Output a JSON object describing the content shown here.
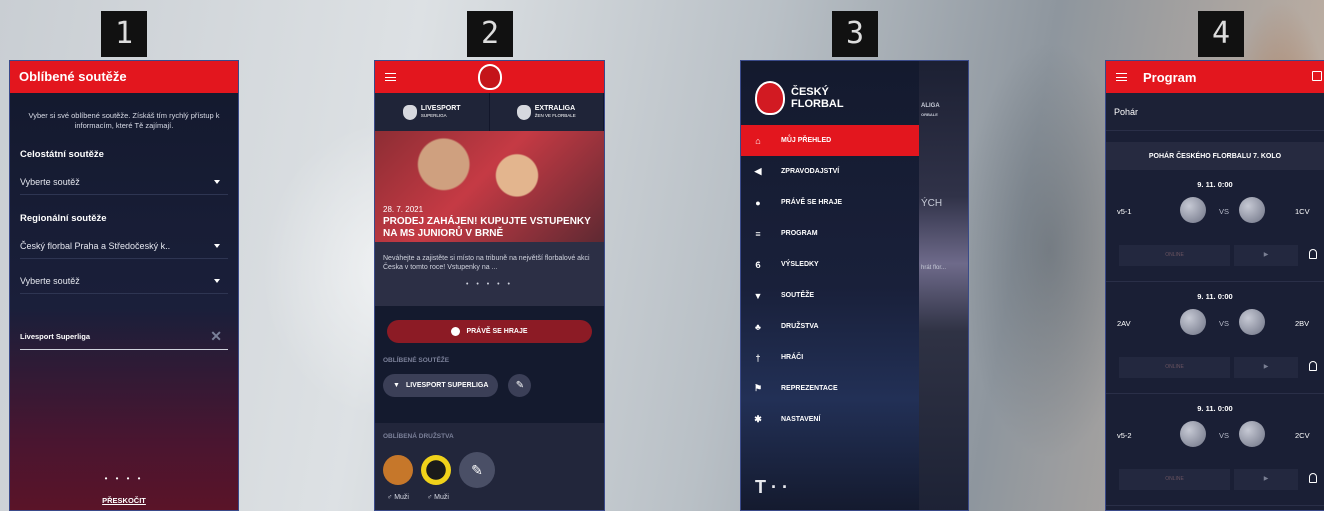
{
  "labels": [
    "1",
    "2",
    "3",
    "4"
  ],
  "screen1": {
    "title": "Oblíbené soutěže",
    "intro": "Vyber si své oblíbené soutěže. Získáš tím rychlý přístup k informacím, které Tě zajímají.",
    "national_heading": "Celostátní soutěže",
    "national_select": "Vyberte soutěž",
    "regional_heading": "Regionální soutěže",
    "regional_select_1": "Český florbal Praha a Středočeský k..",
    "regional_select_2": "Vyberte soutěž",
    "selected_chip": "Livesport Superliga",
    "dots": "• • • •",
    "skip": "PŘESKOČIT"
  },
  "screen2": {
    "league_1": "LIVESPORT",
    "league_1_sub": "SUPERLIGA",
    "league_2": "EXTRALIGA",
    "league_2_sub": "ŽEN VE FLORBALE",
    "news_date": "28. 7. 2021",
    "news_title": "PRODEJ ZAHÁJEN! KUPUJTE VSTUPENKY NA MS JUNIORŮ V BRNĚ",
    "news_desc": "Neváhejte a zajistěte si místo na tribuně na největší florbalové akci Česka v tomto roce! Vstupenky na ...",
    "dots": "• • • • •",
    "live_button": "PRÁVĚ SE HRAJE",
    "fav_comp_label": "OBLÍBENÉ SOUTĚŽE",
    "fav_comp": "LIVESPORT SUPERLIGA",
    "fav_teams_label": "OBLÍBENÁ DRUŽSTVA",
    "team_1_cat": "♂ Muži",
    "team_2_cat": "♂ Muži"
  },
  "screen3": {
    "logo_line1": "ČESKÝ",
    "logo_line2": "FLORBAL",
    "menu": [
      "MŮJ PŘEHLED",
      "ZPRAVODAJSTVÍ",
      "PRÁVĚ SE HRAJE",
      "PROGRAM",
      "VÝSLEDKY",
      "SOUTĚŽE",
      "DRUŽSTVA",
      "HRÁČI",
      "REPREZENTACE",
      "NASTAVENÍ"
    ],
    "menu_icons": [
      "home-icon",
      "megaphone-icon",
      "ball-icon",
      "list-icon",
      "medal-icon",
      "trophy-icon",
      "team-icon",
      "player-icon",
      "flag-icon",
      "gear-icon"
    ],
    "bg_text_1": "ALIGA",
    "bg_text_2": "ORBALE",
    "bg_text_3": "ÝCH",
    "bg_text_4": "hrát flor...",
    "brand": "T · ·"
  },
  "screen4": {
    "title": "Program",
    "cup": "Pohár",
    "round": "POHÁR ČESKÉHO FLORBALU 7. KOLO",
    "matches": [
      {
        "time": "9. 11. 0:00",
        "home": "v5-1",
        "away": "1CV",
        "vs": "VS",
        "online": "ONLINE",
        "play": "▶"
      },
      {
        "time": "9. 11. 0:00",
        "home": "2AV",
        "away": "2BV",
        "vs": "VS",
        "online": "ONLINE",
        "play": "▶"
      },
      {
        "time": "9. 11. 0:00",
        "home": "v5-2",
        "away": "2CV",
        "vs": "VS",
        "online": "ONLINE",
        "play": "▶"
      }
    ]
  },
  "colors": {
    "accent": "#e3161e",
    "navy": "#141a2e"
  }
}
